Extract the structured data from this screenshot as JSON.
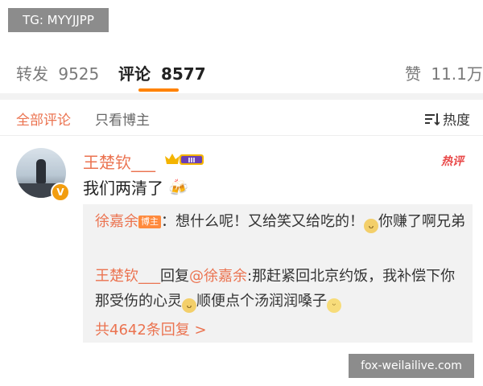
{
  "watermark_top": "TG: MYYJJPP",
  "watermark_bottom": "fox-weilailive.com",
  "tabs": {
    "repost": {
      "label": "转发",
      "count": "9525"
    },
    "comment": {
      "label": "评论",
      "count": "8577"
    },
    "like": {
      "label": "赞",
      "count": "11.1万"
    }
  },
  "filters": {
    "all": "全部评论",
    "author_only": "只看博主",
    "sort": "热度"
  },
  "comment": {
    "username": "王楚钦___",
    "level_badge": "III",
    "verified_badge": "V",
    "hot_tag": "热评",
    "text": "我们两清了",
    "text_emoji": "🍻"
  },
  "replies": [
    {
      "name": "徐嘉余",
      "badge": "博主",
      "text": "：想什么呢！又给笑又给吃的！",
      "emoji": "doge",
      "text2": "你赚了啊兄弟"
    },
    {
      "name": "王楚钦___",
      "reply_word": "回复",
      "mention": "@徐嘉余",
      "text": ":那赶紧回北京约饭，我补偿下你那受伤的心灵",
      "emoji": "doge",
      "text2": "顺便点个汤润润嗓子",
      "emoji2": "smile"
    }
  ],
  "more_replies": "共4642条回复 >",
  "colors": {
    "accent": "#eb7350",
    "tab_underline": "#ff8200",
    "reply_bg": "#f2f2f2"
  }
}
